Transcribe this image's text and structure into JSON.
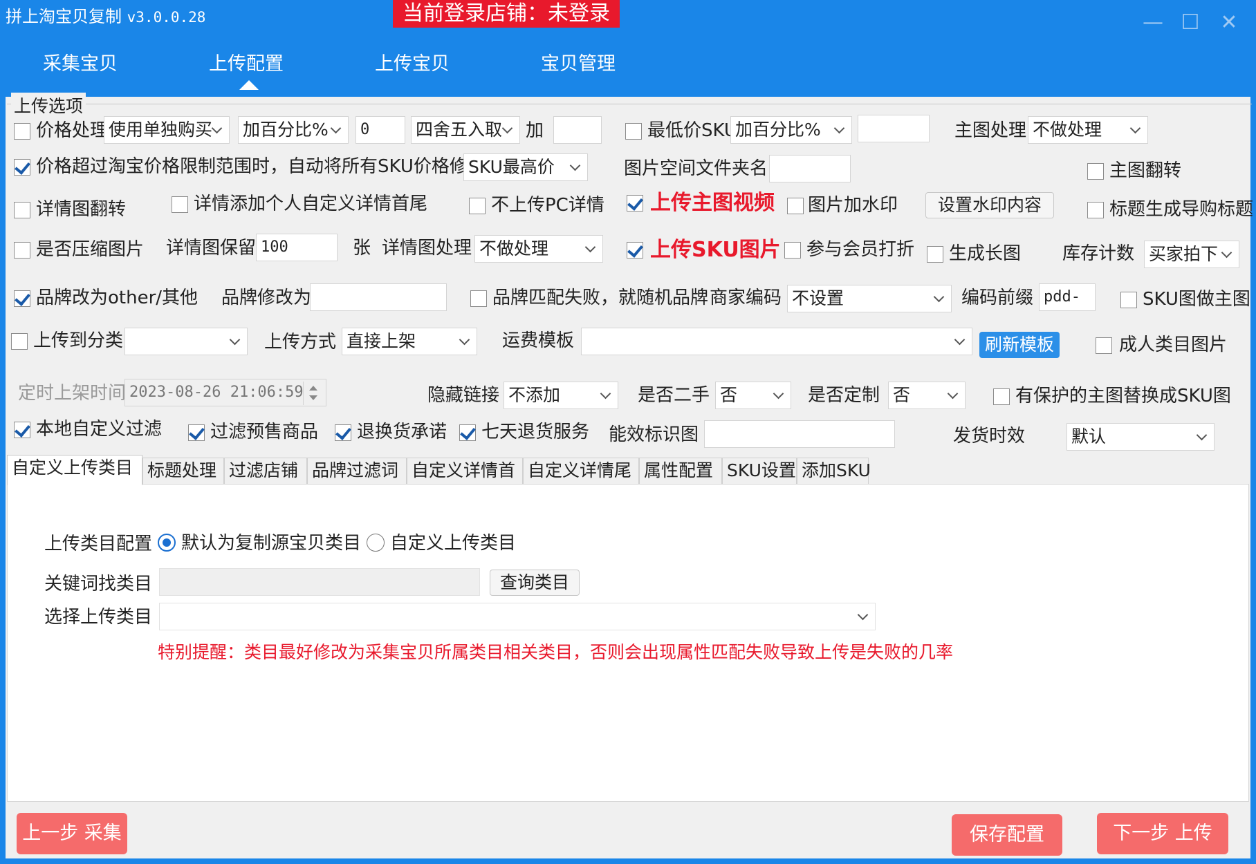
{
  "window": {
    "title": "拼上淘宝贝复制",
    "version": "v3.0.0.28",
    "login_status": "当前登录店铺：未登录",
    "minimize": "—",
    "maximize": "☐",
    "close": "✕"
  },
  "nav": {
    "tabs": [
      {
        "label": "采集宝贝"
      },
      {
        "label": "上传配置"
      },
      {
        "label": "上传宝贝"
      },
      {
        "label": "宝贝管理"
      }
    ],
    "active": "上传配置"
  },
  "upload_options": {
    "legend": "上传选项",
    "price_process": {
      "label": "价格处理",
      "checked": false,
      "buy_type": "使用单独购买",
      "method": "加百分比%",
      "value": "0",
      "rounding": "四舍五入取",
      "add_label": "加",
      "add_value": ""
    },
    "min_price_sku": {
      "label": "最低价SKU",
      "checked": false,
      "method": "加百分比%",
      "value": ""
    },
    "main_image_process": {
      "label": "主图处理",
      "value": "不做处理"
    },
    "price_over_limit": {
      "label": "价格超过淘宝价格限制范围时，自动将所有SKU价格修改为",
      "checked": true,
      "value": "SKU最高价"
    },
    "image_folder": {
      "label": "图片空间文件夹名",
      "value": ""
    },
    "main_image_flip": {
      "label": "主图翻转",
      "checked": false
    },
    "detail_image_flip": {
      "label": "详情图翻转",
      "checked": false
    },
    "detail_custom_head_tail": {
      "label": "详情添加个人自定义详情首尾",
      "checked": false
    },
    "no_pc_detail": {
      "label": "不上传PC详情",
      "checked": false
    },
    "upload_main_video": {
      "label": "上传主图视频",
      "checked": true
    },
    "image_watermark": {
      "label": "图片加水印",
      "checked": false
    },
    "watermark_button": "设置水印内容",
    "title_shopping_guide": {
      "label": "标题生成导购标题",
      "checked": false
    },
    "compress_images": {
      "label": "是否压缩图片",
      "checked": false
    },
    "detail_keep": {
      "label": "详情图保留",
      "value": "100",
      "unit": "张"
    },
    "detail_image_process": {
      "label": "详情图处理",
      "value": "不做处理"
    },
    "upload_sku_images": {
      "label": "上传SKU图片",
      "checked": true
    },
    "member_discount": {
      "label": "参与会员打折",
      "checked": false
    },
    "long_image": {
      "label": "生成长图",
      "checked": false
    },
    "stock_count": {
      "label": "库存计数",
      "value": "买家拍下"
    },
    "brand_other": {
      "label": "品牌改为other/其他",
      "checked": true
    },
    "brand_change_to": {
      "label": "品牌修改为",
      "value": ""
    },
    "brand_random": {
      "label": "品牌匹配失败，就随机品牌",
      "checked": false
    },
    "merchant_code": {
      "label": "商家编码",
      "value": "不设置"
    },
    "code_prefix": {
      "label": "编码前缀",
      "value": "pdd-"
    },
    "sku_as_main": {
      "label": "SKU图做主图",
      "checked": false
    },
    "upload_to_category": {
      "label": "上传到分类",
      "checked": false,
      "value": ""
    },
    "upload_method": {
      "label": "上传方式",
      "value": "直接上架"
    },
    "shipping_template": {
      "label": "运费模板",
      "value": ""
    },
    "refresh_template": "刷新模板",
    "adult_category_image": {
      "label": "成人类目图片",
      "checked": false
    },
    "scheduled_time": {
      "label": "定时上架时间",
      "value": "2023-08-26 21:06:59"
    },
    "hidden_link": {
      "label": "隐藏链接",
      "value": "不添加"
    },
    "second_hand": {
      "label": "是否二手",
      "value": "否"
    },
    "customized": {
      "label": "是否定制",
      "value": "否"
    },
    "protected_main_replace": {
      "label": "有保护的主图替换成SKU图",
      "checked": false
    },
    "local_filter": {
      "label": "本地自定义过滤",
      "checked": true
    },
    "filter_presale": {
      "label": "过滤预售商品",
      "checked": true
    },
    "return_promise": {
      "label": "退换货承诺",
      "checked": true
    },
    "seven_day_return": {
      "label": "七天退货服务",
      "checked": true
    },
    "energy_label": {
      "label": "能效标识图",
      "value": ""
    },
    "delivery_time": {
      "label": "发货时效",
      "value": "默认"
    }
  },
  "sub_tabs": [
    {
      "label": "自定义上传类目"
    },
    {
      "label": "标题处理"
    },
    {
      "label": "过滤店铺"
    },
    {
      "label": "品牌过滤词"
    },
    {
      "label": "自定义详情首"
    },
    {
      "label": "自定义详情尾"
    },
    {
      "label": "属性配置"
    },
    {
      "label": "SKU设置"
    },
    {
      "label": "添加SKU"
    }
  ],
  "category_panel": {
    "config_label": "上传类目配置",
    "option_default": "默认为复制源宝贝类目",
    "option_custom": "自定义上传类目",
    "selected": "默认为复制源宝贝类目",
    "keyword_label": "关键词找类目",
    "keyword_value": "",
    "query_button": "查询类目",
    "select_label": "选择上传类目",
    "select_value": "",
    "warning": "特别提醒：类目最好修改为采集宝贝所属类目相关类目，否则会出现属性匹配失败导致上传是失败的几率"
  },
  "footer": {
    "prev": "上一步 采集",
    "save": "保存配置",
    "next": "下一步 上传"
  },
  "colors": {
    "accent": "#1a86e8",
    "danger": "#e8192c",
    "action": "#f56b6b"
  }
}
